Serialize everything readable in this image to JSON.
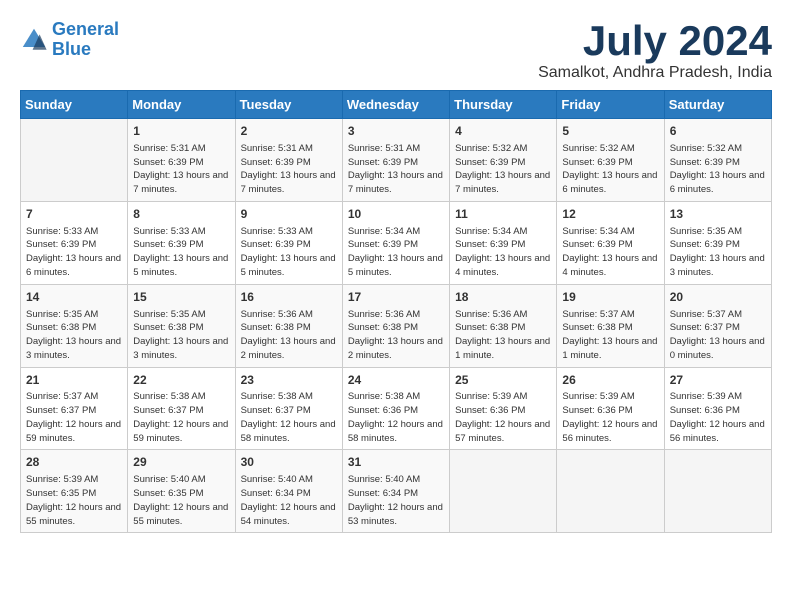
{
  "header": {
    "logo_line1": "General",
    "logo_line2": "Blue",
    "month": "July 2024",
    "location": "Samalkot, Andhra Pradesh, India"
  },
  "weekdays": [
    "Sunday",
    "Monday",
    "Tuesday",
    "Wednesday",
    "Thursday",
    "Friday",
    "Saturday"
  ],
  "weeks": [
    [
      {
        "day": "",
        "empty": true
      },
      {
        "day": "1",
        "sunrise": "5:31 AM",
        "sunset": "6:39 PM",
        "daylight": "13 hours and 7 minutes."
      },
      {
        "day": "2",
        "sunrise": "5:31 AM",
        "sunset": "6:39 PM",
        "daylight": "13 hours and 7 minutes."
      },
      {
        "day": "3",
        "sunrise": "5:31 AM",
        "sunset": "6:39 PM",
        "daylight": "13 hours and 7 minutes."
      },
      {
        "day": "4",
        "sunrise": "5:32 AM",
        "sunset": "6:39 PM",
        "daylight": "13 hours and 7 minutes."
      },
      {
        "day": "5",
        "sunrise": "5:32 AM",
        "sunset": "6:39 PM",
        "daylight": "13 hours and 6 minutes."
      },
      {
        "day": "6",
        "sunrise": "5:32 AM",
        "sunset": "6:39 PM",
        "daylight": "13 hours and 6 minutes."
      }
    ],
    [
      {
        "day": "7",
        "sunrise": "5:33 AM",
        "sunset": "6:39 PM",
        "daylight": "13 hours and 6 minutes."
      },
      {
        "day": "8",
        "sunrise": "5:33 AM",
        "sunset": "6:39 PM",
        "daylight": "13 hours and 5 minutes."
      },
      {
        "day": "9",
        "sunrise": "5:33 AM",
        "sunset": "6:39 PM",
        "daylight": "13 hours and 5 minutes."
      },
      {
        "day": "10",
        "sunrise": "5:34 AM",
        "sunset": "6:39 PM",
        "daylight": "13 hours and 5 minutes."
      },
      {
        "day": "11",
        "sunrise": "5:34 AM",
        "sunset": "6:39 PM",
        "daylight": "13 hours and 4 minutes."
      },
      {
        "day": "12",
        "sunrise": "5:34 AM",
        "sunset": "6:39 PM",
        "daylight": "13 hours and 4 minutes."
      },
      {
        "day": "13",
        "sunrise": "5:35 AM",
        "sunset": "6:39 PM",
        "daylight": "13 hours and 3 minutes."
      }
    ],
    [
      {
        "day": "14",
        "sunrise": "5:35 AM",
        "sunset": "6:38 PM",
        "daylight": "13 hours and 3 minutes."
      },
      {
        "day": "15",
        "sunrise": "5:35 AM",
        "sunset": "6:38 PM",
        "daylight": "13 hours and 3 minutes."
      },
      {
        "day": "16",
        "sunrise": "5:36 AM",
        "sunset": "6:38 PM",
        "daylight": "13 hours and 2 minutes."
      },
      {
        "day": "17",
        "sunrise": "5:36 AM",
        "sunset": "6:38 PM",
        "daylight": "13 hours and 2 minutes."
      },
      {
        "day": "18",
        "sunrise": "5:36 AM",
        "sunset": "6:38 PM",
        "daylight": "13 hours and 1 minute."
      },
      {
        "day": "19",
        "sunrise": "5:37 AM",
        "sunset": "6:38 PM",
        "daylight": "13 hours and 1 minute."
      },
      {
        "day": "20",
        "sunrise": "5:37 AM",
        "sunset": "6:37 PM",
        "daylight": "13 hours and 0 minutes."
      }
    ],
    [
      {
        "day": "21",
        "sunrise": "5:37 AM",
        "sunset": "6:37 PM",
        "daylight": "12 hours and 59 minutes."
      },
      {
        "day": "22",
        "sunrise": "5:38 AM",
        "sunset": "6:37 PM",
        "daylight": "12 hours and 59 minutes."
      },
      {
        "day": "23",
        "sunrise": "5:38 AM",
        "sunset": "6:37 PM",
        "daylight": "12 hours and 58 minutes."
      },
      {
        "day": "24",
        "sunrise": "5:38 AM",
        "sunset": "6:36 PM",
        "daylight": "12 hours and 58 minutes."
      },
      {
        "day": "25",
        "sunrise": "5:39 AM",
        "sunset": "6:36 PM",
        "daylight": "12 hours and 57 minutes."
      },
      {
        "day": "26",
        "sunrise": "5:39 AM",
        "sunset": "6:36 PM",
        "daylight": "12 hours and 56 minutes."
      },
      {
        "day": "27",
        "sunrise": "5:39 AM",
        "sunset": "6:36 PM",
        "daylight": "12 hours and 56 minutes."
      }
    ],
    [
      {
        "day": "28",
        "sunrise": "5:39 AM",
        "sunset": "6:35 PM",
        "daylight": "12 hours and 55 minutes."
      },
      {
        "day": "29",
        "sunrise": "5:40 AM",
        "sunset": "6:35 PM",
        "daylight": "12 hours and 55 minutes."
      },
      {
        "day": "30",
        "sunrise": "5:40 AM",
        "sunset": "6:34 PM",
        "daylight": "12 hours and 54 minutes."
      },
      {
        "day": "31",
        "sunrise": "5:40 AM",
        "sunset": "6:34 PM",
        "daylight": "12 hours and 53 minutes."
      },
      {
        "day": "",
        "empty": true
      },
      {
        "day": "",
        "empty": true
      },
      {
        "day": "",
        "empty": true
      }
    ]
  ]
}
